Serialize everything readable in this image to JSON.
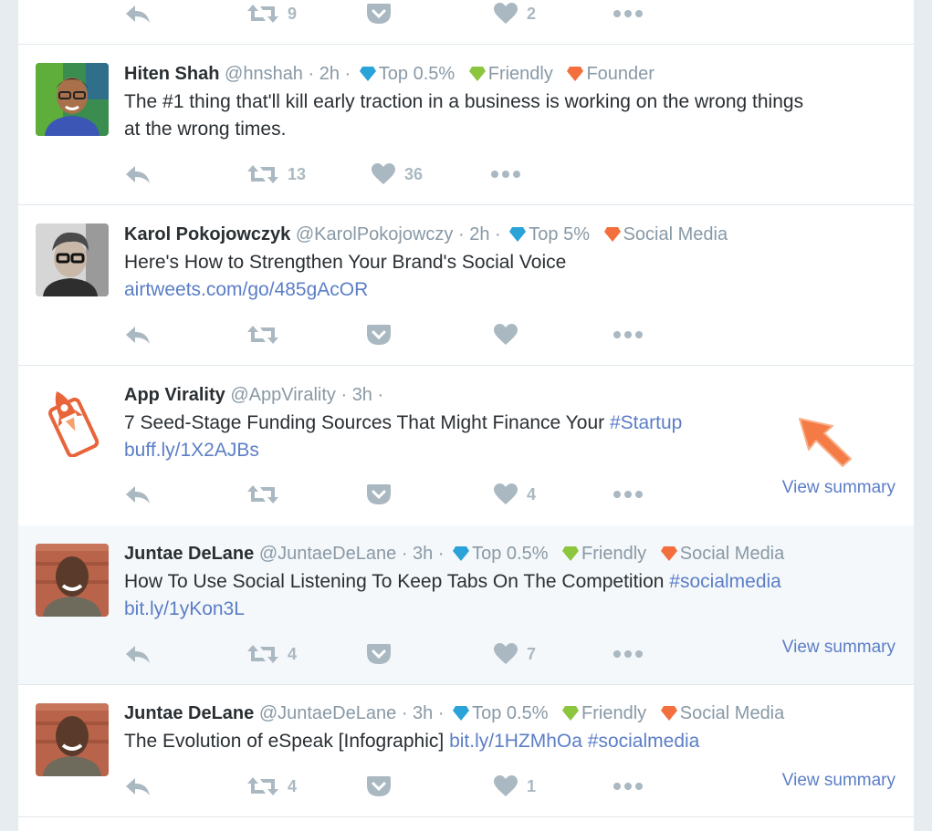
{
  "top_actions": {
    "retweet_count": "9",
    "like_count": "2"
  },
  "tweets": [
    {
      "name": "Hiten Shah",
      "handle": "@hnshah",
      "time": "2h",
      "badges": [
        {
          "label": "Top 0.5%",
          "icon": "diamond-icon",
          "color": "#2aa3d8"
        },
        {
          "label": "Friendly",
          "icon": "diamond-icon",
          "color": "#8cc63f"
        },
        {
          "label": "Founder",
          "icon": "diamond-icon",
          "color": "#f36f3d"
        }
      ],
      "text_line1": "The #1 thing that'll kill early traction in a business is working on the wrong things",
      "text_line2": "at the wrong times.",
      "retweet_count": "13",
      "like_count": "36"
    },
    {
      "name": "Karol Pokojowczyk",
      "handle": "@KarolPokojowczy",
      "time": "2h",
      "badges": [
        {
          "label": "Top 5%",
          "icon": "diamond-icon",
          "color": "#2aa3d8"
        },
        {
          "label": "Social Media",
          "icon": "diamond-icon",
          "color": "#f36f3d"
        }
      ],
      "text_line1": "Here's How to Strengthen Your Brand's Social Voice",
      "link": "airtweets.com/go/485gAcOR"
    },
    {
      "name": "App Virality",
      "handle": "@AppVirality",
      "time": "3h",
      "text_line1": "7 Seed-Stage Funding Sources That Might Finance Your ",
      "hashtag": "#Startup",
      "link": "buff.ly/1X2AJBs",
      "like_count": "4",
      "view_summary": "View summary"
    },
    {
      "name": "Juntae DeLane",
      "handle": "@JuntaeDeLane",
      "time": "3h",
      "badges": [
        {
          "label": "Top 0.5%",
          "icon": "diamond-icon",
          "color": "#2aa3d8"
        },
        {
          "label": "Friendly",
          "icon": "diamond-icon",
          "color": "#8cc63f"
        },
        {
          "label": "Social Media",
          "icon": "diamond-icon",
          "color": "#f36f3d"
        }
      ],
      "text_line1": "How To Use Social Listening To Keep Tabs On The Competition ",
      "hashtag": "#socialmedia",
      "link": "bit.ly/1yKon3L",
      "retweet_count": "4",
      "like_count": "7",
      "view_summary": "View summary"
    },
    {
      "name": "Juntae DeLane",
      "handle": "@JuntaeDeLane",
      "time": "3h",
      "badges": [
        {
          "label": "Top 0.5%",
          "icon": "diamond-icon",
          "color": "#2aa3d8"
        },
        {
          "label": "Friendly",
          "icon": "diamond-icon",
          "color": "#8cc63f"
        },
        {
          "label": "Social Media",
          "icon": "diamond-icon",
          "color": "#f36f3d"
        }
      ],
      "text_line1": "The Evolution of eSpeak [Infographic] ",
      "link": "bit.ly/1HZMhOa",
      "hashtag": "#socialmedia",
      "retweet_count": "4",
      "like_count": "1",
      "view_summary": "View summary"
    }
  ],
  "colors": {
    "link": "#5b7ec6",
    "muted": "#8899a6",
    "icon": "#aab8c2",
    "highlight_bg": "#f5f8fa",
    "cursor_arrow": "#f47b45"
  }
}
